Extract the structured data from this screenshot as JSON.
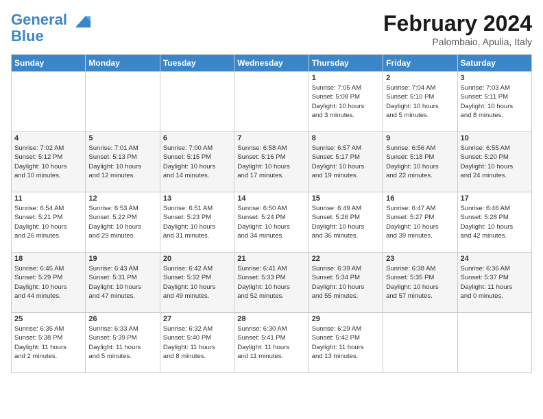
{
  "logo": {
    "line1": "General",
    "line2": "Blue"
  },
  "header": {
    "month_title": "February 2024",
    "location": "Palombaio, Apulia, Italy"
  },
  "days_of_week": [
    "Sunday",
    "Monday",
    "Tuesday",
    "Wednesday",
    "Thursday",
    "Friday",
    "Saturday"
  ],
  "weeks": [
    [
      {
        "day": "",
        "info": ""
      },
      {
        "day": "",
        "info": ""
      },
      {
        "day": "",
        "info": ""
      },
      {
        "day": "",
        "info": ""
      },
      {
        "day": "1",
        "info": "Sunrise: 7:05 AM\nSunset: 5:08 PM\nDaylight: 10 hours\nand 3 minutes."
      },
      {
        "day": "2",
        "info": "Sunrise: 7:04 AM\nSunset: 5:10 PM\nDaylight: 10 hours\nand 5 minutes."
      },
      {
        "day": "3",
        "info": "Sunrise: 7:03 AM\nSunset: 5:11 PM\nDaylight: 10 hours\nand 8 minutes."
      }
    ],
    [
      {
        "day": "4",
        "info": "Sunrise: 7:02 AM\nSunset: 5:12 PM\nDaylight: 10 hours\nand 10 minutes."
      },
      {
        "day": "5",
        "info": "Sunrise: 7:01 AM\nSunset: 5:13 PM\nDaylight: 10 hours\nand 12 minutes."
      },
      {
        "day": "6",
        "info": "Sunrise: 7:00 AM\nSunset: 5:15 PM\nDaylight: 10 hours\nand 14 minutes."
      },
      {
        "day": "7",
        "info": "Sunrise: 6:58 AM\nSunset: 5:16 PM\nDaylight: 10 hours\nand 17 minutes."
      },
      {
        "day": "8",
        "info": "Sunrise: 6:57 AM\nSunset: 5:17 PM\nDaylight: 10 hours\nand 19 minutes."
      },
      {
        "day": "9",
        "info": "Sunrise: 6:56 AM\nSunset: 5:18 PM\nDaylight: 10 hours\nand 22 minutes."
      },
      {
        "day": "10",
        "info": "Sunrise: 6:55 AM\nSunset: 5:20 PM\nDaylight: 10 hours\nand 24 minutes."
      }
    ],
    [
      {
        "day": "11",
        "info": "Sunrise: 6:54 AM\nSunset: 5:21 PM\nDaylight: 10 hours\nand 26 minutes."
      },
      {
        "day": "12",
        "info": "Sunrise: 6:53 AM\nSunset: 5:22 PM\nDaylight: 10 hours\nand 29 minutes."
      },
      {
        "day": "13",
        "info": "Sunrise: 6:51 AM\nSunset: 5:23 PM\nDaylight: 10 hours\nand 31 minutes."
      },
      {
        "day": "14",
        "info": "Sunrise: 6:50 AM\nSunset: 5:24 PM\nDaylight: 10 hours\nand 34 minutes."
      },
      {
        "day": "15",
        "info": "Sunrise: 6:49 AM\nSunset: 5:26 PM\nDaylight: 10 hours\nand 36 minutes."
      },
      {
        "day": "16",
        "info": "Sunrise: 6:47 AM\nSunset: 5:27 PM\nDaylight: 10 hours\nand 39 minutes."
      },
      {
        "day": "17",
        "info": "Sunrise: 6:46 AM\nSunset: 5:28 PM\nDaylight: 10 hours\nand 42 minutes."
      }
    ],
    [
      {
        "day": "18",
        "info": "Sunrise: 6:45 AM\nSunset: 5:29 PM\nDaylight: 10 hours\nand 44 minutes."
      },
      {
        "day": "19",
        "info": "Sunrise: 6:43 AM\nSunset: 5:31 PM\nDaylight: 10 hours\nand 47 minutes."
      },
      {
        "day": "20",
        "info": "Sunrise: 6:42 AM\nSunset: 5:32 PM\nDaylight: 10 hours\nand 49 minutes."
      },
      {
        "day": "21",
        "info": "Sunrise: 6:41 AM\nSunset: 5:33 PM\nDaylight: 10 hours\nand 52 minutes."
      },
      {
        "day": "22",
        "info": "Sunrise: 6:39 AM\nSunset: 5:34 PM\nDaylight: 10 hours\nand 55 minutes."
      },
      {
        "day": "23",
        "info": "Sunrise: 6:38 AM\nSunset: 5:35 PM\nDaylight: 10 hours\nand 57 minutes."
      },
      {
        "day": "24",
        "info": "Sunrise: 6:36 AM\nSunset: 5:37 PM\nDaylight: 11 hours\nand 0 minutes."
      }
    ],
    [
      {
        "day": "25",
        "info": "Sunrise: 6:35 AM\nSunset: 5:38 PM\nDaylight: 11 hours\nand 2 minutes."
      },
      {
        "day": "26",
        "info": "Sunrise: 6:33 AM\nSunset: 5:39 PM\nDaylight: 11 hours\nand 5 minutes."
      },
      {
        "day": "27",
        "info": "Sunrise: 6:32 AM\nSunset: 5:40 PM\nDaylight: 11 hours\nand 8 minutes."
      },
      {
        "day": "28",
        "info": "Sunrise: 6:30 AM\nSunset: 5:41 PM\nDaylight: 11 hours\nand 11 minutes."
      },
      {
        "day": "29",
        "info": "Sunrise: 6:29 AM\nSunset: 5:42 PM\nDaylight: 11 hours\nand 13 minutes."
      },
      {
        "day": "",
        "info": ""
      },
      {
        "day": "",
        "info": ""
      }
    ]
  ]
}
